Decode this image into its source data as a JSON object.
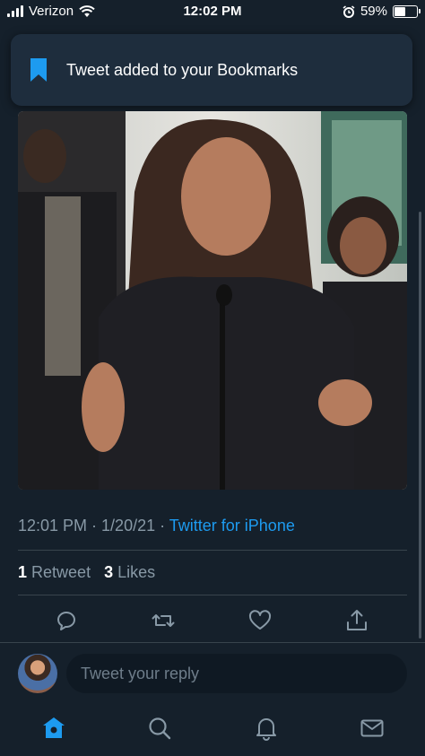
{
  "status_bar": {
    "carrier": "Verizon",
    "time": "12:02 PM",
    "battery": "59%",
    "battery_level": 0.59,
    "icons": [
      "signal-icon",
      "wifi-icon",
      "alarm-icon",
      "battery-icon"
    ]
  },
  "toast": {
    "icon": "bookmark-icon",
    "message": "Tweet added to your Bookmarks",
    "accent": "#1d9bf0"
  },
  "tweet": {
    "time": "12:01 PM",
    "sep1": " · ",
    "date": "1/20/21",
    "sep2": " · ",
    "source": "Twitter for iPhone",
    "retweets": "1",
    "retweets_label": "Retweet",
    "likes": "3",
    "likes_label": "Likes"
  },
  "actions": [
    "reply-icon",
    "retweet-icon",
    "like-icon",
    "share-icon"
  ],
  "reply": {
    "placeholder": "Tweet your reply"
  },
  "tab_bar": [
    "home-icon",
    "search-icon",
    "notifications-icon",
    "messages-icon"
  ],
  "colors": {
    "background": "#15202b",
    "accent": "#1d9bf0",
    "secondary_text": "#8899a6",
    "divider": "#38444d"
  }
}
